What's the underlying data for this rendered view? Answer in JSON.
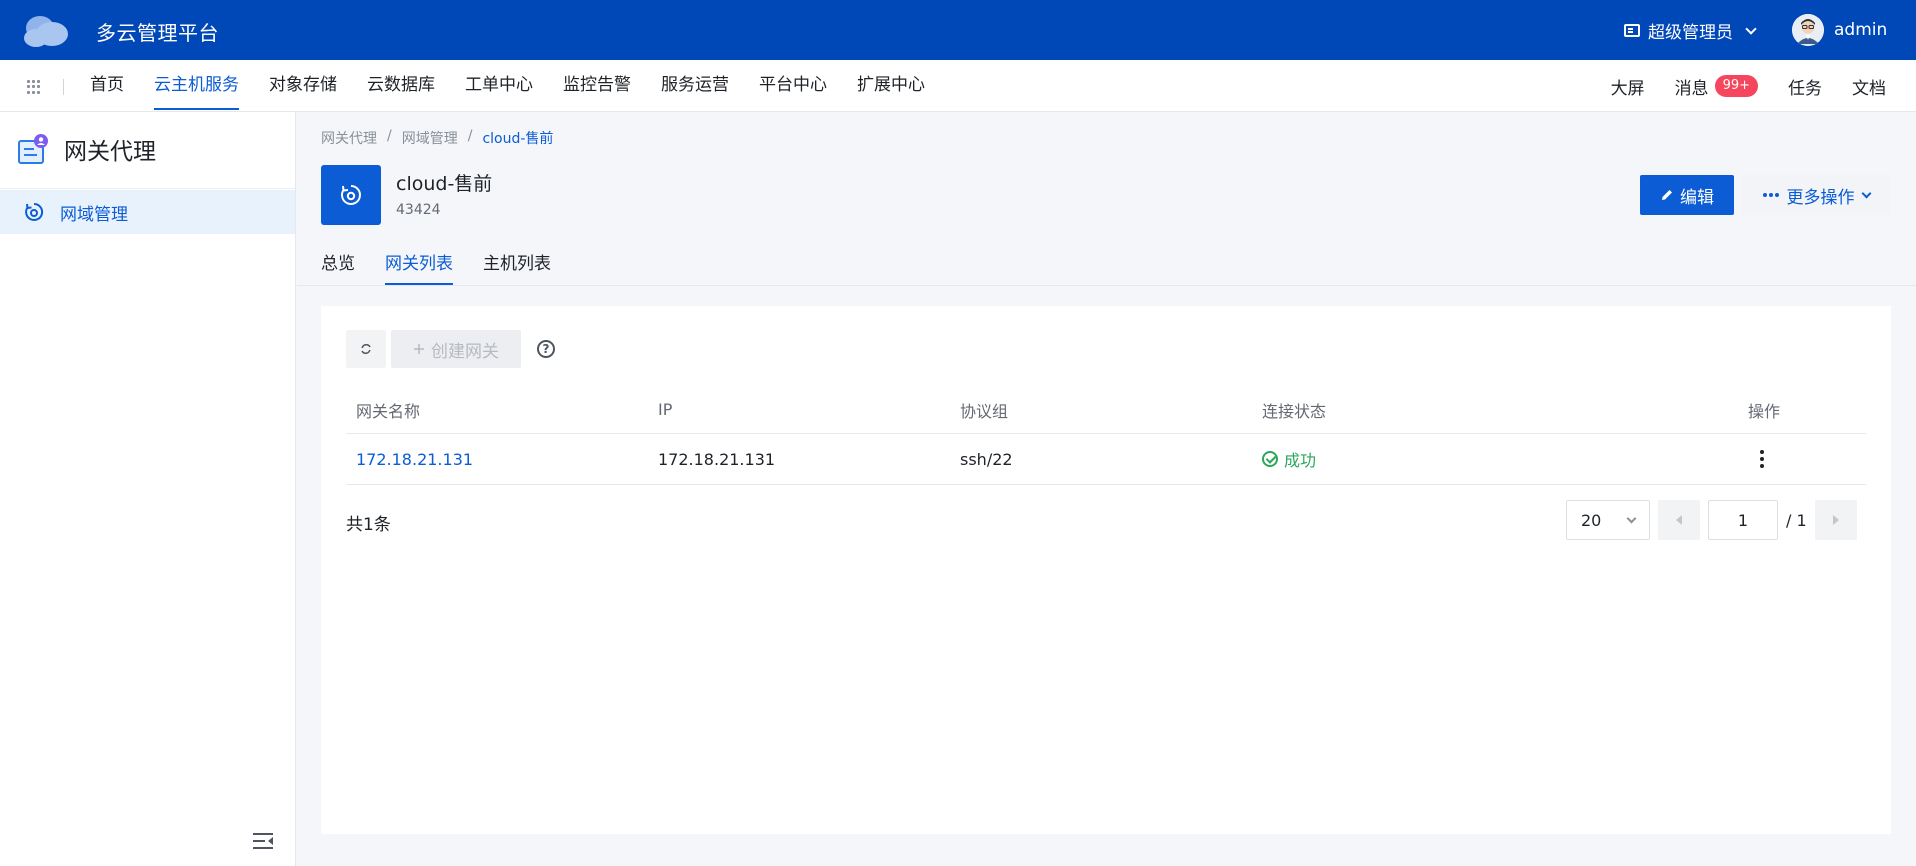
{
  "header": {
    "app_title": "多云管理平台",
    "role": "超级管理员",
    "username": "admin"
  },
  "nav": {
    "items": [
      {
        "label": "首页",
        "active": false
      },
      {
        "label": "云主机服务",
        "active": true
      },
      {
        "label": "对象存储",
        "active": false
      },
      {
        "label": "云数据库",
        "active": false
      },
      {
        "label": "工单中心",
        "active": false
      },
      {
        "label": "监控告警",
        "active": false
      },
      {
        "label": "服务运营",
        "active": false
      },
      {
        "label": "平台中心",
        "active": false
      },
      {
        "label": "扩展中心",
        "active": false
      }
    ],
    "right": {
      "screen": "大屏",
      "messages": "消息",
      "messages_badge": "99+",
      "tasks": "任务",
      "docs": "文档"
    }
  },
  "sidebar": {
    "title": "网关代理",
    "items": [
      {
        "label": "网域管理",
        "active": true
      }
    ]
  },
  "breadcrumb": [
    "网关代理",
    "网域管理",
    "cloud-售前"
  ],
  "resource": {
    "name": "cloud-售前",
    "id": "43424",
    "edit_label": "编辑",
    "more_label": "更多操作"
  },
  "tabs": [
    {
      "label": "总览",
      "active": false
    },
    {
      "label": "网关列表",
      "active": true
    },
    {
      "label": "主机列表",
      "active": false
    }
  ],
  "toolbar": {
    "create_label": "创建网关"
  },
  "table": {
    "columns": [
      "网关名称",
      "IP",
      "协议组",
      "连接状态",
      "操作"
    ],
    "rows": [
      {
        "name": "172.18.21.131",
        "ip": "172.18.21.131",
        "protocol": "ssh/22",
        "status": "成功"
      }
    ]
  },
  "pagination": {
    "total_text": "共1条",
    "page_size": "20",
    "current_page": "1",
    "total_pages": "/ 1"
  },
  "colors": {
    "header_bg": "#0047b8",
    "primary": "#0b5cd5",
    "success": "#2ca65d",
    "badge": "#f5465e"
  }
}
